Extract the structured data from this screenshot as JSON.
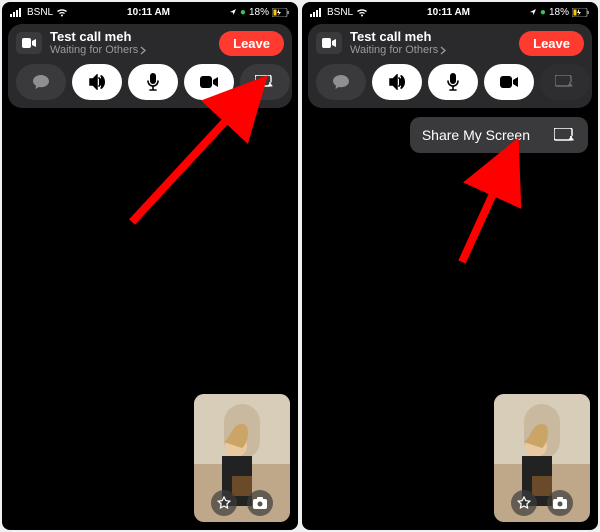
{
  "status": {
    "carrier": "BSNL",
    "time": "10:11 AM",
    "battery": "18%"
  },
  "call": {
    "title": "Test call meh",
    "subtitle": "Waiting for Others"
  },
  "leave_label": "Leave",
  "popup": {
    "share_label": "Share My Screen"
  },
  "colors": {
    "leave": "#ff3b30",
    "panel": "#2a2a2c"
  }
}
